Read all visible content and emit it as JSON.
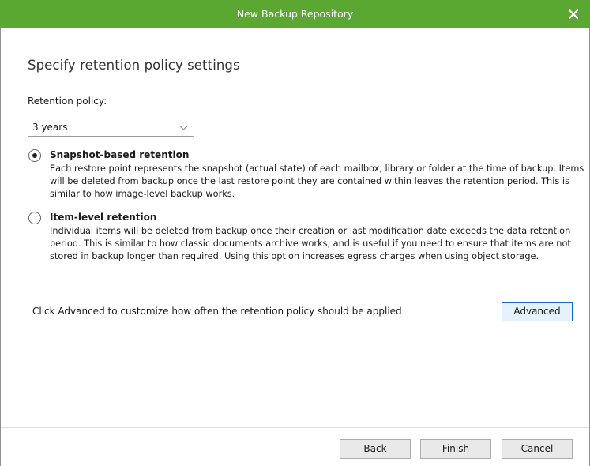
{
  "window": {
    "title": "New Backup Repository"
  },
  "page": {
    "heading": "Specify retention policy settings"
  },
  "retention": {
    "label": "Retention policy:",
    "selected": "3 years"
  },
  "options": [
    {
      "title": "Snapshot-based retention",
      "selected": true,
      "description": "Each restore point represents the snapshot (actual state) of each mailbox, library or folder at the time of backup. Items will be deleted from backup once the last restore point they are contained within leaves the retention period. This is similar to how image-level backup works."
    },
    {
      "title": "Item-level retention",
      "selected": false,
      "description": "Individual items will be deleted from backup once their creation or last modification date exceeds the data retention period. This is similar to how classic documents archive works, and is useful if you need to ensure that items are not stored in backup longer than required. Using this option increases egress charges when using object storage."
    }
  ],
  "advanced": {
    "hint": "Click Advanced to customize how often the retention policy should be applied",
    "button_label": "Advanced"
  },
  "footer": {
    "back_label": "Back",
    "finish_label": "Finish",
    "cancel_label": "Cancel"
  },
  "colors": {
    "titlebar": "#5aa832",
    "focus_border": "#0f6fc6"
  }
}
